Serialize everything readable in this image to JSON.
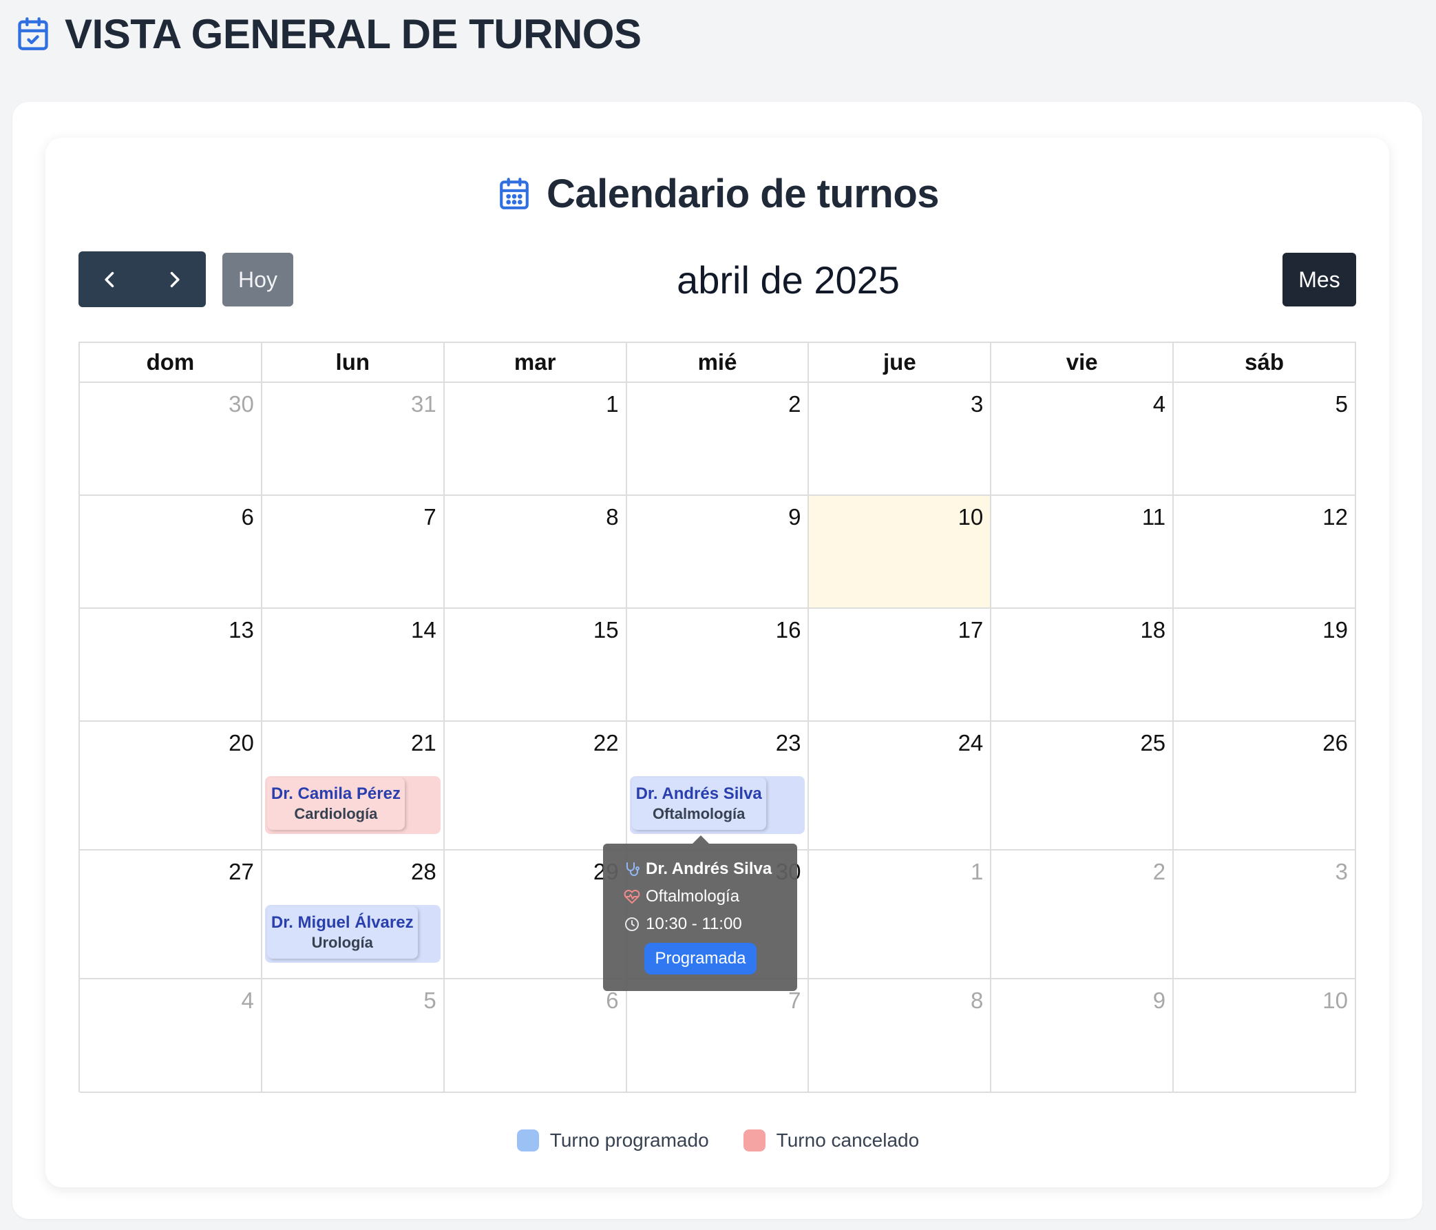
{
  "page": {
    "title": "VISTA GENERAL DE TURNOS",
    "icon": "calendar-check-icon"
  },
  "calendar": {
    "title": "Calendario de turnos",
    "icon": "calendar-days-icon",
    "month_label": "abril de 2025",
    "today_label": "Hoy",
    "view_label": "Mes",
    "prev_icon": "chevron-left-icon",
    "next_icon": "chevron-right-icon",
    "day_headers": [
      "dom",
      "lun",
      "mar",
      "mié",
      "jue",
      "vie",
      "sáb"
    ],
    "weeks": [
      [
        {
          "d": "30",
          "other": true
        },
        {
          "d": "31",
          "other": true
        },
        {
          "d": "1"
        },
        {
          "d": "2"
        },
        {
          "d": "3"
        },
        {
          "d": "4"
        },
        {
          "d": "5"
        }
      ],
      [
        {
          "d": "6"
        },
        {
          "d": "7"
        },
        {
          "d": "8"
        },
        {
          "d": "9"
        },
        {
          "d": "10",
          "today": true
        },
        {
          "d": "11"
        },
        {
          "d": "12"
        }
      ],
      [
        {
          "d": "13"
        },
        {
          "d": "14"
        },
        {
          "d": "15"
        },
        {
          "d": "16"
        },
        {
          "d": "17"
        },
        {
          "d": "18"
        },
        {
          "d": "19"
        }
      ],
      [
        {
          "d": "20"
        },
        {
          "d": "21",
          "event": {
            "doctor": "Dr. Camila Pérez",
            "specialty": "Cardiología",
            "status": "cancelled"
          }
        },
        {
          "d": "22"
        },
        {
          "d": "23",
          "event": {
            "doctor": "Dr. Andrés Silva",
            "specialty": "Oftalmología",
            "status": "scheduled"
          }
        },
        {
          "d": "24"
        },
        {
          "d": "25"
        },
        {
          "d": "26"
        }
      ],
      [
        {
          "d": "27"
        },
        {
          "d": "28",
          "event": {
            "doctor": "Dr. Miguel Álvarez",
            "specialty": "Urología",
            "status": "scheduled"
          }
        },
        {
          "d": "29"
        },
        {
          "d": "30"
        },
        {
          "d": "1",
          "other": true
        },
        {
          "d": "2",
          "other": true
        },
        {
          "d": "3",
          "other": true
        }
      ],
      [
        {
          "d": "4",
          "other": true
        },
        {
          "d": "5",
          "other": true
        },
        {
          "d": "6",
          "other": true
        },
        {
          "d": "7",
          "other": true
        },
        {
          "d": "8",
          "other": true
        },
        {
          "d": "9",
          "other": true
        },
        {
          "d": "10",
          "other": true
        }
      ]
    ]
  },
  "tooltip": {
    "doctor": "Dr. Andrés Silva",
    "specialty": "Oftalmología",
    "time": "10:30 - 11:00",
    "status": "Programada",
    "icons": [
      "stethoscope-icon",
      "heart-pulse-icon",
      "clock-icon"
    ]
  },
  "legend": [
    {
      "label": "Turno programado",
      "color": "#9cc2f5"
    },
    {
      "label": "Turno cancelado",
      "color": "#f5a3a3"
    }
  ],
  "colors": {
    "accent": "#2f6fe0",
    "today_bg": "#fef8e4",
    "scheduled_bg": "#d5defa",
    "cancelled_bg": "#fad6d6",
    "badge": "#2f78f1"
  }
}
